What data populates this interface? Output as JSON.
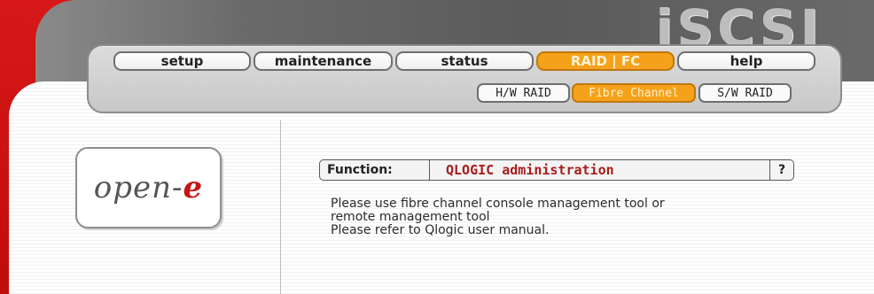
{
  "brand": {
    "logo_text": "iSCSI"
  },
  "nav": {
    "tabs": [
      {
        "label": "setup"
      },
      {
        "label": "maintenance"
      },
      {
        "label": "status"
      },
      {
        "label": "RAID | FC",
        "active": true
      },
      {
        "label": "help"
      }
    ],
    "subtabs": [
      {
        "label": "H/W RAID"
      },
      {
        "label": "Fibre Channel",
        "active": true
      },
      {
        "label": "S/W RAID"
      }
    ]
  },
  "logo": {
    "text_main": "open-",
    "text_accent": "e"
  },
  "function": {
    "label": "Function:",
    "title": "QLOGIC administration",
    "help": "?"
  },
  "message": {
    "lines": [
      "Please use fibre channel console management tool or",
      "remote management tool",
      "Please refer to Qlogic user manual."
    ]
  },
  "colors": {
    "accent_orange": "#f5a21a",
    "brand_red": "#c00c0c",
    "title_red": "#a81c1c"
  }
}
